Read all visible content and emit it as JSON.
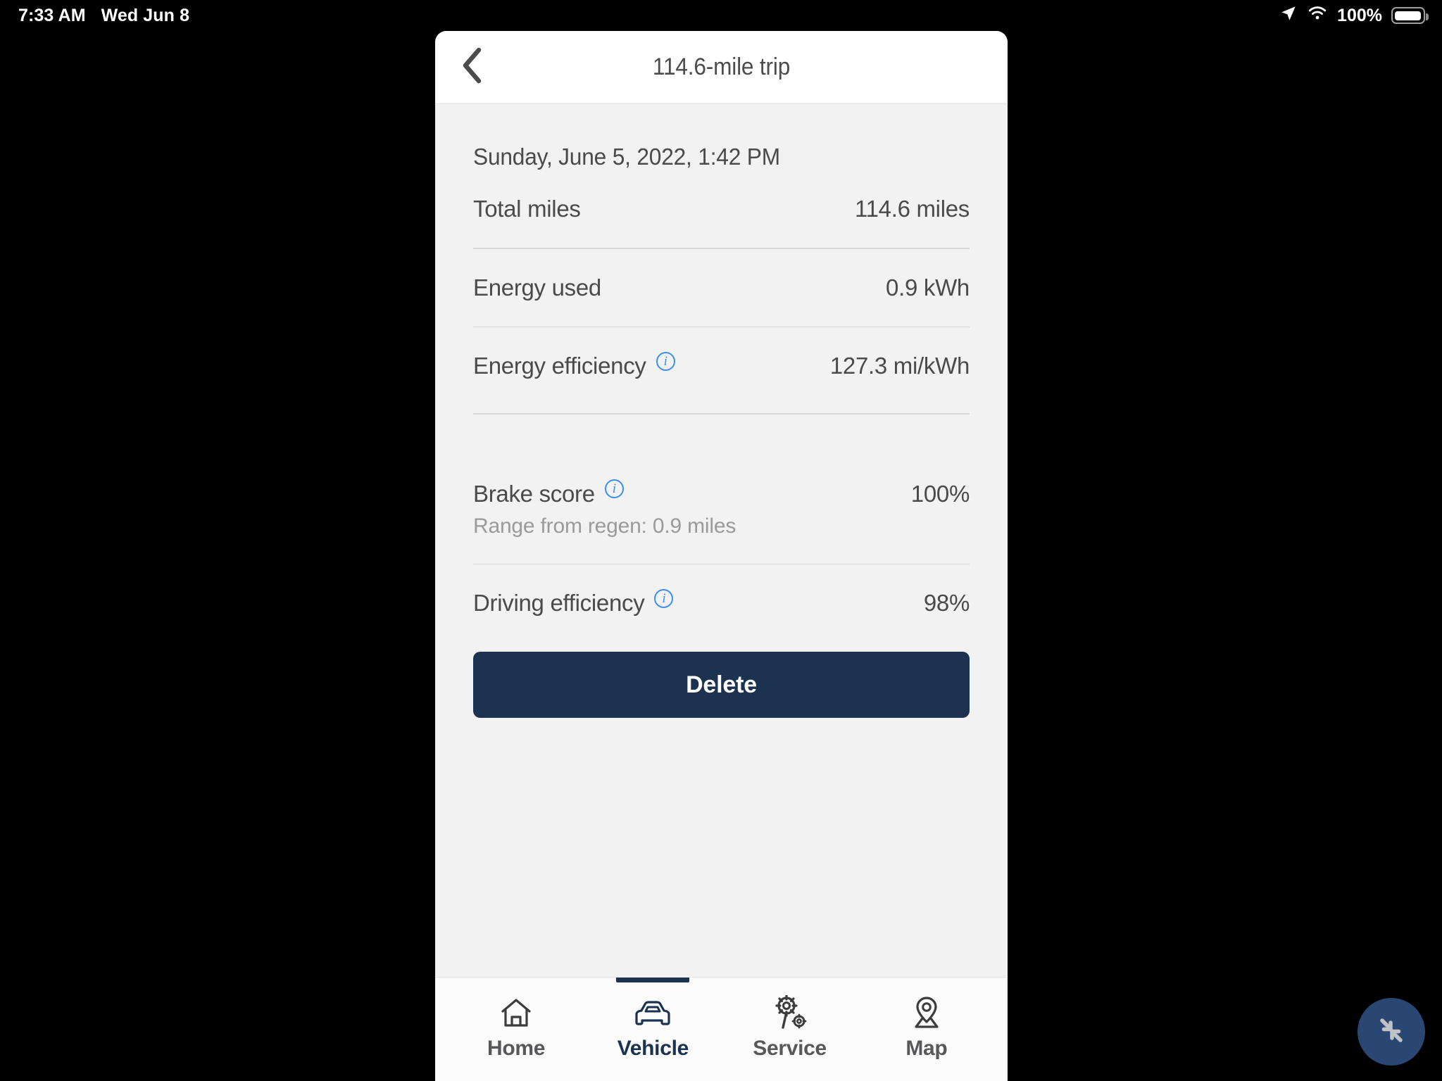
{
  "status_bar": {
    "time": "7:33 AM",
    "date": "Wed Jun 8",
    "battery_percent": "100%",
    "icons": [
      "location-arrow-icon",
      "wifi-icon",
      "battery-icon"
    ]
  },
  "header": {
    "back_label": "back-chevron-icon",
    "title": "114.6-mile trip"
  },
  "trip": {
    "date_time": "Sunday, June 5, 2022, 1:42 PM",
    "rows": [
      {
        "label": "Total miles",
        "value": "114.6 miles",
        "info": false,
        "sub": ""
      },
      {
        "label": "Energy used",
        "value": "0.9 kWh",
        "info": false,
        "sub": ""
      },
      {
        "label": "Energy efficiency",
        "value": "127.3 mi/kWh",
        "info": true,
        "sub": ""
      },
      {
        "label": "Brake score",
        "value": "100%",
        "info": true,
        "sub": "Range from regen: 0.9 miles"
      },
      {
        "label": "Driving efficiency",
        "value": "98%",
        "info": true,
        "sub": ""
      }
    ]
  },
  "actions": {
    "delete_label": "Delete"
  },
  "tabbar": {
    "items": [
      {
        "label": "Home",
        "icon": "home-icon",
        "active": false
      },
      {
        "label": "Vehicle",
        "icon": "car-icon",
        "active": true
      },
      {
        "label": "Service",
        "icon": "wrench-gear-icon",
        "active": false
      },
      {
        "label": "Map",
        "icon": "map-pin-icon",
        "active": false
      }
    ]
  },
  "floating_button": {
    "icon": "collapse-arrows-icon"
  },
  "colors": {
    "accent_navy": "#1b3250",
    "info_blue": "#3b8ef0",
    "page_bg": "#f2f2f2",
    "text_primary": "#4a4a4a",
    "text_muted": "#9a9a9a"
  }
}
